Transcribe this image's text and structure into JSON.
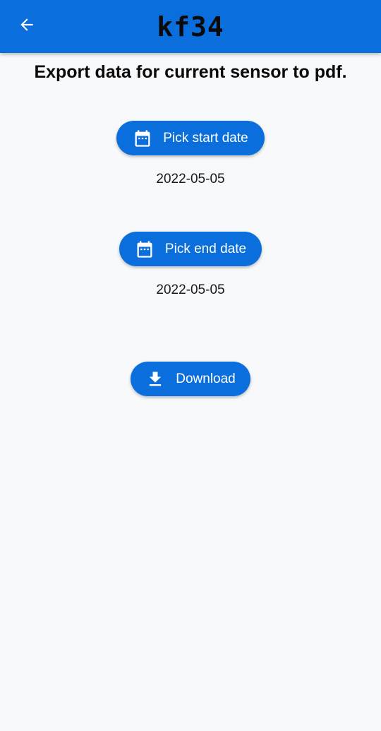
{
  "app_bar": {
    "title": "kf34",
    "back_icon": "arrow-left-icon",
    "color": "#0a6fdc"
  },
  "main": {
    "heading": "Export data for current sensor to pdf.",
    "start_date_button": {
      "label": "Pick start date",
      "icon": "calendar-icon"
    },
    "start_date_value": "2022-05-05",
    "end_date_button": {
      "label": "Pick end date",
      "icon": "calendar-icon"
    },
    "end_date_value": "2022-05-05",
    "download_button": {
      "label": "Download",
      "icon": "download-icon"
    }
  }
}
